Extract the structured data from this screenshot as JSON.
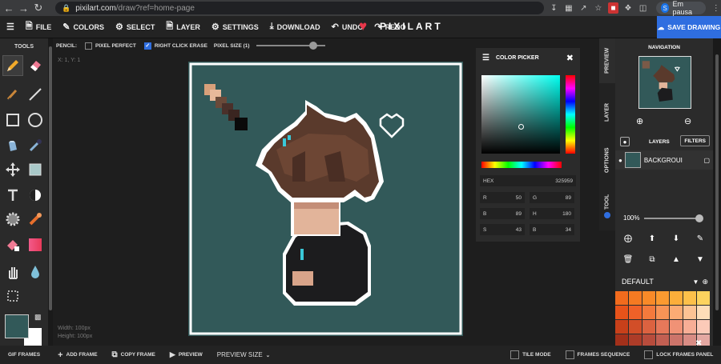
{
  "browser": {
    "url_host": "pixilart.com",
    "url_path": "/draw?ref=home-page",
    "profile_initial": "S",
    "profile_status": "Em pausa"
  },
  "menu": {
    "file": "FILE",
    "colors": "COLORS",
    "select": "SELECT",
    "layer": "LAYER",
    "settings": "SETTINGS",
    "download": "DOWNLOAD",
    "undo": "UNDO",
    "redo": "REDO",
    "logo": "PIXILART",
    "save": "SAVE DRAWING"
  },
  "tools_title": "TOOLS",
  "options": {
    "pencil": "PENCIL:",
    "pixel_perfect": "PIXEL PERFECT",
    "right_click_erase": "RIGHT CLICK ERASE",
    "pixel_size": "PIXEL SIZE (1)"
  },
  "canvas": {
    "coords": "X: 1, Y: 1",
    "width": "Width: 100px",
    "height": "Height: 100px"
  },
  "picker": {
    "title": "COLOR PICKER",
    "hex_label": "HEX",
    "hex_value": "325959",
    "r_label": "R",
    "r": "50",
    "g_label": "G",
    "g": "89",
    "b_label": "B",
    "b": "89",
    "h_label": "H",
    "h": "180",
    "s_label": "S",
    "s": "43",
    "b2_label": "B",
    "b2": "34"
  },
  "vtabs": {
    "preview": "PREVIEW",
    "layer": "LAYER",
    "options": "OPTIONS",
    "tool": "TOOL"
  },
  "rpanel": {
    "navigation": "NAVIGATION",
    "layers": "LAYERS",
    "filters": "FILTERS",
    "layer_name": "BACKGROUI",
    "opacity": "100%",
    "palette": "DEFAULT"
  },
  "bottom": {
    "gif_frames": "GIF FRAMES",
    "add_frame": "ADD FRAME",
    "copy_frame": "COPY FRAME",
    "preview": "PREVIEW",
    "preview_size": "PREVIEW SIZE",
    "tile_mode": "TILE MODE",
    "frames_sequence": "FRAMES SEQUENCE",
    "lock_frames": "LOCK FRAMES PANEL"
  },
  "colors": {
    "accent": "#2f6ee0",
    "canvas_bg": "#325959",
    "hair": "#5a3a2c",
    "skin": "#e2b49a"
  },
  "palette_swatches": [
    "#f26b1d",
    "#f57a22",
    "#f88a28",
    "#fb9a30",
    "#fcae3a",
    "#fdc04a",
    "#fdd35e",
    "#e8531a",
    "#f06128",
    "#f47a3c",
    "#f89456",
    "#fbab74",
    "#fdc394",
    "#feddb8",
    "#c8401a",
    "#d24e28",
    "#dc6240",
    "#e6785a",
    "#f09276",
    "#f8ae96",
    "#fccab8",
    "#a3301a",
    "#ad3c28",
    "#b84c3c",
    "#c25f52",
    "#cc746a",
    "#d88c84",
    "#e4a8a2",
    "#7a2414",
    "#84301f",
    "#8f3d2d",
    "#9a4c3e",
    "#a65d52",
    "#b27068",
    "#c08680"
  ]
}
